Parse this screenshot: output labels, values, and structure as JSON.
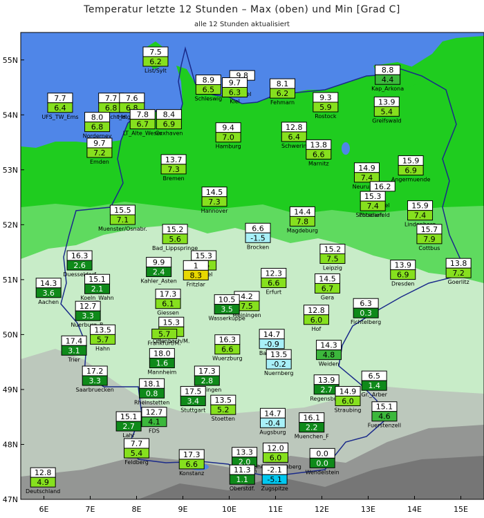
{
  "header": {
    "title": "Temperatur letzte 12 Stunden – Max (oben) und Min [Grad C]",
    "subtitle": "alle 12 Stunden aktualisiert"
  },
  "axes": {
    "lon_ticks": [
      "6E",
      "7E",
      "8E",
      "9E",
      "10E",
      "11E",
      "12E",
      "13E",
      "14E",
      "15E"
    ],
    "lat_ticks": [
      "55N",
      "54N",
      "53N",
      "52N",
      "51N",
      "50N",
      "49N",
      "48N",
      "47N"
    ],
    "lon_range": [
      5.5,
      15.5
    ],
    "lat_range": [
      47,
      55.5
    ]
  },
  "colors": {
    "sea": "#4f86e8",
    "lowland": "#1fcc1f",
    "lowland_light": "#7be07b",
    "upland": "#c8ecc8",
    "highland": "#b5b5b5",
    "alps": "#8a8a8a",
    "border": "#1a2a8a",
    "min_band_1": "#0f8a1a",
    "min_band_2": "#3cb83c",
    "min_band_3": "#86e01e",
    "min_band_4": "#c8f000",
    "min_band_5": "#e8d800",
    "min_band_6": "#00e0e0",
    "min_band_7": "#a8f0f8"
  },
  "stations": [
    {
      "name": "List/Sylt",
      "max": "7.5",
      "min": "6.2",
      "min_color": "#86e01e",
      "lon": 8.41,
      "lat": 55.01
    },
    {
      "name": "UFS_TW_Ems",
      "max": "7.7",
      "min": "6.4",
      "min_color": "#86e01e",
      "lon": 6.35,
      "lat": 54.17
    },
    {
      "name": "Dt.Bucht_H.",
      "max": "7.7",
      "min": "6.8",
      "min_color": "#86e01e",
      "lon": 7.45,
      "lat": 54.17
    },
    {
      "name": "Helgoland",
      "max": "7.6",
      "min": "6.8",
      "min_color": "#86e01e",
      "lon": 7.9,
      "lat": 54.17
    },
    {
      "name": "Schleswig",
      "max": "8.9",
      "min": "6.5",
      "min_color": "#86e01e",
      "lon": 9.55,
      "lat": 54.5
    },
    {
      "name": "LT_Kiel",
      "max": "9.8",
      "min": "",
      "min_color": "#86e01e",
      "lon": 10.28,
      "lat": 54.58
    },
    {
      "name": "Kiel",
      "max": "9.7",
      "min": "6.3",
      "min_color": "#86e01e",
      "lon": 10.12,
      "lat": 54.45
    },
    {
      "name": "Fehmarn",
      "max": "8.1",
      "min": "6.2",
      "min_color": "#86e01e",
      "lon": 11.15,
      "lat": 54.43
    },
    {
      "name": "Kap_Arkona",
      "max": "8.8",
      "min": "4.4",
      "min_color": "#3cb83c",
      "lon": 13.42,
      "lat": 54.68
    },
    {
      "name": "Norderney",
      "max": "8.0",
      "min": "6.8",
      "min_color": "#86e01e",
      "lon": 7.15,
      "lat": 53.82
    },
    {
      "name": "Cuxhaven",
      "max": "8.4",
      "min": "6.9",
      "min_color": "#86e01e",
      "lon": 8.7,
      "lat": 53.87
    },
    {
      "name": "LT_Alte_Weser",
      "max": "7.8",
      "min": "6.7",
      "min_color": "#86e01e",
      "lon": 8.13,
      "lat": 53.87
    },
    {
      "name": "Rostock",
      "max": "9.3",
      "min": "5.9",
      "min_color": "#86e01e",
      "lon": 12.08,
      "lat": 54.18
    },
    {
      "name": "Greifswald",
      "max": "13.9",
      "min": "5.4",
      "min_color": "#86e01e",
      "lon": 13.4,
      "lat": 54.1
    },
    {
      "name": "Emden",
      "max": "9.7",
      "min": "7.2",
      "min_color": "#86e01e",
      "lon": 7.2,
      "lat": 53.35
    },
    {
      "name": "Hamburg",
      "max": "9.4",
      "min": "7.0",
      "min_color": "#86e01e",
      "lon": 9.98,
      "lat": 53.63
    },
    {
      "name": "Schwerin",
      "max": "12.8",
      "min": "6.4",
      "min_color": "#86e01e",
      "lon": 11.4,
      "lat": 53.64
    },
    {
      "name": "Marnitz",
      "max": "13.8",
      "min": "6.6",
      "min_color": "#86e01e",
      "lon": 11.93,
      "lat": 53.32
    },
    {
      "name": "Angermuende",
      "max": "15.9",
      "min": "6.9",
      "min_color": "#86e01e",
      "lon": 13.92,
      "lat": 53.03
    },
    {
      "name": "Bremen",
      "max": "13.7",
      "min": "7.3",
      "min_color": "#86e01e",
      "lon": 8.8,
      "lat": 53.05
    },
    {
      "name": "Neuruppin",
      "max": "14.9",
      "min": "7.4",
      "min_color": "#86e01e",
      "lon": 12.97,
      "lat": 52.9
    },
    {
      "name": "Tegel",
      "max": "16.2",
      "min": "",
      "min_color": "#86e01e",
      "lon": 13.31,
      "lat": 52.56
    },
    {
      "name": "Schoenefeld",
      "max": "15.3",
      "min": "7.4",
      "min_color": "#86e01e",
      "lon": 13.1,
      "lat": 52.38
    },
    {
      "name": "Hannover",
      "max": "14.5",
      "min": "7.3",
      "min_color": "#86e01e",
      "lon": 9.68,
      "lat": 52.46
    },
    {
      "name": "Potsdam",
      "max": "",
      "min": "",
      "min_color": "#86e01e",
      "lon": 13.06,
      "lat": 52.38
    },
    {
      "name": "Lindenberg",
      "max": "15.9",
      "min": "7.4",
      "min_color": "#86e01e",
      "lon": 14.12,
      "lat": 52.21
    },
    {
      "name": "Muenster/Osnabr.",
      "max": "15.5",
      "min": "7.1",
      "min_color": "#86e01e",
      "lon": 7.7,
      "lat": 52.13
    },
    {
      "name": "Magdeburg",
      "max": "14.4",
      "min": "7.8",
      "min_color": "#86e01e",
      "lon": 11.58,
      "lat": 52.1
    },
    {
      "name": "Cottbus",
      "max": "15.7",
      "min": "7.9",
      "min_color": "#86e01e",
      "lon": 14.32,
      "lat": 51.78
    },
    {
      "name": "Bad_Lippspringe",
      "max": "15.2",
      "min": "5.6",
      "min_color": "#86e01e",
      "lon": 8.83,
      "lat": 51.78
    },
    {
      "name": "Brocken",
      "max": "6.6",
      "min": "-1.5",
      "min_color": "#a8f0f8",
      "lon": 10.62,
      "lat": 51.8
    },
    {
      "name": "Duesseldorf",
      "max": "16.3",
      "min": "2.6",
      "min_color": "#0f8a1a",
      "lon": 6.77,
      "lat": 51.3
    },
    {
      "name": "Kassel",
      "max": "15.3",
      "min": "7.5",
      "min_color": "#86e01e",
      "lon": 9.45,
      "lat": 51.3
    },
    {
      "name": "Fritzlar",
      "max": "1",
      "min": "8.3",
      "min_color": "#e8d800",
      "lon": 9.28,
      "lat": 51.12
    },
    {
      "name": "Leipzig",
      "max": "15.2",
      "min": "7.5",
      "min_color": "#86e01e",
      "lon": 12.23,
      "lat": 51.42
    },
    {
      "name": "Dresden",
      "max": "13.9",
      "min": "6.9",
      "min_color": "#86e01e",
      "lon": 13.75,
      "lat": 51.13
    },
    {
      "name": "Goerlitz",
      "max": "13.8",
      "min": "7.2",
      "min_color": "#86e01e",
      "lon": 14.95,
      "lat": 51.16
    },
    {
      "name": "Koeln_Wahn",
      "max": "15.1",
      "min": "2.1",
      "min_color": "#0f8a1a",
      "lon": 7.15,
      "lat": 50.87
    },
    {
      "name": "Kahler_Asten",
      "max": "9.9",
      "min": "2.4",
      "min_color": "#0f8a1a",
      "lon": 8.48,
      "lat": 51.18
    },
    {
      "name": "Erfurt",
      "max": "12.3",
      "min": "6.6",
      "min_color": "#86e01e",
      "lon": 10.96,
      "lat": 50.98
    },
    {
      "name": "Gera",
      "max": "14.5",
      "min": "6.7",
      "min_color": "#86e01e",
      "lon": 12.12,
      "lat": 50.88
    },
    {
      "name": "Aachen",
      "max": "14.3",
      "min": "3.6",
      "min_color": "#0f8a1a",
      "lon": 6.1,
      "lat": 50.8
    },
    {
      "name": "Giessen",
      "max": "17.3",
      "min": "6.1",
      "min_color": "#86e01e",
      "lon": 8.68,
      "lat": 50.6
    },
    {
      "name": "Meiningen",
      "max": "4.2",
      "min": "7.5",
      "min_color": "#86e01e",
      "lon": 10.38,
      "lat": 50.56
    },
    {
      "name": "Wasserkuppe",
      "max": "10.5",
      "min": "3.5",
      "min_color": "#0f8a1a",
      "lon": 9.95,
      "lat": 50.5
    },
    {
      "name": "Nuerburg_B.",
      "max": "12.7",
      "min": "3.3",
      "min_color": "#0f8a1a",
      "lon": 6.95,
      "lat": 50.38
    },
    {
      "name": "Offenbach/M.",
      "max": "15.3",
      "min": "6.1",
      "min_color": "#86e01e",
      "lon": 8.75,
      "lat": 50.09
    },
    {
      "name": "Fichtelberg",
      "max": "6.3",
      "min": "0.3",
      "min_color": "#0f8a1a",
      "lon": 12.95,
      "lat": 50.43
    },
    {
      "name": "Hof",
      "max": "12.8",
      "min": "6.0",
      "min_color": "#86e01e",
      "lon": 11.88,
      "lat": 50.31
    },
    {
      "name": "Bamberg",
      "max": "14.7",
      "min": "-0.9",
      "min_color": "#a8f0f8",
      "lon": 10.92,
      "lat": 49.87
    },
    {
      "name": "Frankfurt/M.",
      "max": "",
      "min": "5.7",
      "min_color": "#86e01e",
      "lon": 8.6,
      "lat": 50.05
    },
    {
      "name": "Hahn",
      "max": "13.5",
      "min": "5.7",
      "min_color": "#86e01e",
      "lon": 7.27,
      "lat": 49.95
    },
    {
      "name": "Trier",
      "max": "17.4",
      "min": "3.1",
      "min_color": "#0f8a1a",
      "lon": 6.65,
      "lat": 49.75
    },
    {
      "name": "Wuerzburg",
      "max": "16.3",
      "min": "6.6",
      "min_color": "#86e01e",
      "lon": 9.96,
      "lat": 49.77
    },
    {
      "name": "Mannheim",
      "max": "18.0",
      "min": "1.6",
      "min_color": "#0f8a1a",
      "lon": 8.55,
      "lat": 49.52
    },
    {
      "name": "Weiden",
      "max": "14.3",
      "min": "4.8",
      "min_color": "#3cb83c",
      "lon": 12.15,
      "lat": 49.67
    },
    {
      "name": "Nuernberg",
      "max": "13.5",
      "min": "-0.2",
      "min_color": "#a8f0f8",
      "lon": 11.07,
      "lat": 49.5
    },
    {
      "name": "Saarbruecken",
      "max": "17.2",
      "min": "3.3",
      "min_color": "#0f8a1a",
      "lon": 7.1,
      "lat": 49.2
    },
    {
      "name": "Oehringen",
      "max": "17.3",
      "min": "2.8",
      "min_color": "#0f8a1a",
      "lon": 9.52,
      "lat": 49.2
    },
    {
      "name": "Regensburg",
      "max": "13.9",
      "min": "2.7",
      "min_color": "#0f8a1a",
      "lon": 12.1,
      "lat": 49.04
    },
    {
      "name": "Gr._Arber",
      "max": "6.5",
      "min": "1.4",
      "min_color": "#0f8a1a",
      "lon": 13.13,
      "lat": 49.11
    },
    {
      "name": "Rheinstetten",
      "max": "18.1",
      "min": "0.8",
      "min_color": "#0f8a1a",
      "lon": 8.33,
      "lat": 48.97
    },
    {
      "name": "Stuttgart",
      "max": "17.5",
      "min": "3.4",
      "min_color": "#0f8a1a",
      "lon": 9.22,
      "lat": 48.83
    },
    {
      "name": "Stoetten",
      "max": "13.5",
      "min": "5.2",
      "min_color": "#86e01e",
      "lon": 9.87,
      "lat": 48.67
    },
    {
      "name": "Straubing",
      "max": "14.9",
      "min": "6.0",
      "min_color": "#86e01e",
      "lon": 12.56,
      "lat": 48.83
    },
    {
      "name": "Fuerstenzell",
      "max": "15.1",
      "min": "4.6",
      "min_color": "#3cb83c",
      "lon": 13.35,
      "lat": 48.55
    },
    {
      "name": "Lahr",
      "max": "15.1",
      "min": "2.7",
      "min_color": "#0f8a1a",
      "lon": 7.83,
      "lat": 48.37
    },
    {
      "name": "FDS",
      "max": "12.7",
      "min": "4.1",
      "min_color": "#3cb83c",
      "lon": 8.38,
      "lat": 48.45
    },
    {
      "name": "Augsburg",
      "max": "14.7",
      "min": "-0.4",
      "min_color": "#a8f0f8",
      "lon": 10.94,
      "lat": 48.43
    },
    {
      "name": "Muenchen_F",
      "max": "16.1",
      "min": "2.2",
      "min_color": "#0f8a1a",
      "lon": 11.78,
      "lat": 48.35
    },
    {
      "name": "Hohenpeissenberg",
      "max": "12.0",
      "min": "6.0",
      "min_color": "#86e01e",
      "lon": 11.0,
      "lat": 47.8
    },
    {
      "name": "Feldberg",
      "max": "7.7",
      "min": "5.4",
      "min_color": "#86e01e",
      "lon": 8.0,
      "lat": 47.88
    },
    {
      "name": "Konstanz",
      "max": "17.3",
      "min": "6.6",
      "min_color": "#86e01e",
      "lon": 9.19,
      "lat": 47.68
    },
    {
      "name": "Kempten",
      "max": "13.3",
      "min": "2.0",
      "min_color": "#0f8a1a",
      "lon": 10.33,
      "lat": 47.72
    },
    {
      "name": "Wendelstein",
      "max": "0.0",
      "min": "0.0",
      "min_color": "#0f8a1a",
      "lon": 12.01,
      "lat": 47.7
    },
    {
      "name": "Oberstdf.",
      "max": "11.3",
      "min": "1.1",
      "min_color": "#0f8a1a",
      "lon": 10.28,
      "lat": 47.4
    },
    {
      "name": "Zugspitze",
      "max": "-2.1",
      "min": "-5.1",
      "min_color": "#00c8f0",
      "lon": 10.98,
      "lat": 47.4
    },
    {
      "name": "Deutschland",
      "max": "12.8",
      "min": "4.9",
      "min_color": "#86e01e",
      "lon": 5.98,
      "lat": 47.35
    }
  ]
}
